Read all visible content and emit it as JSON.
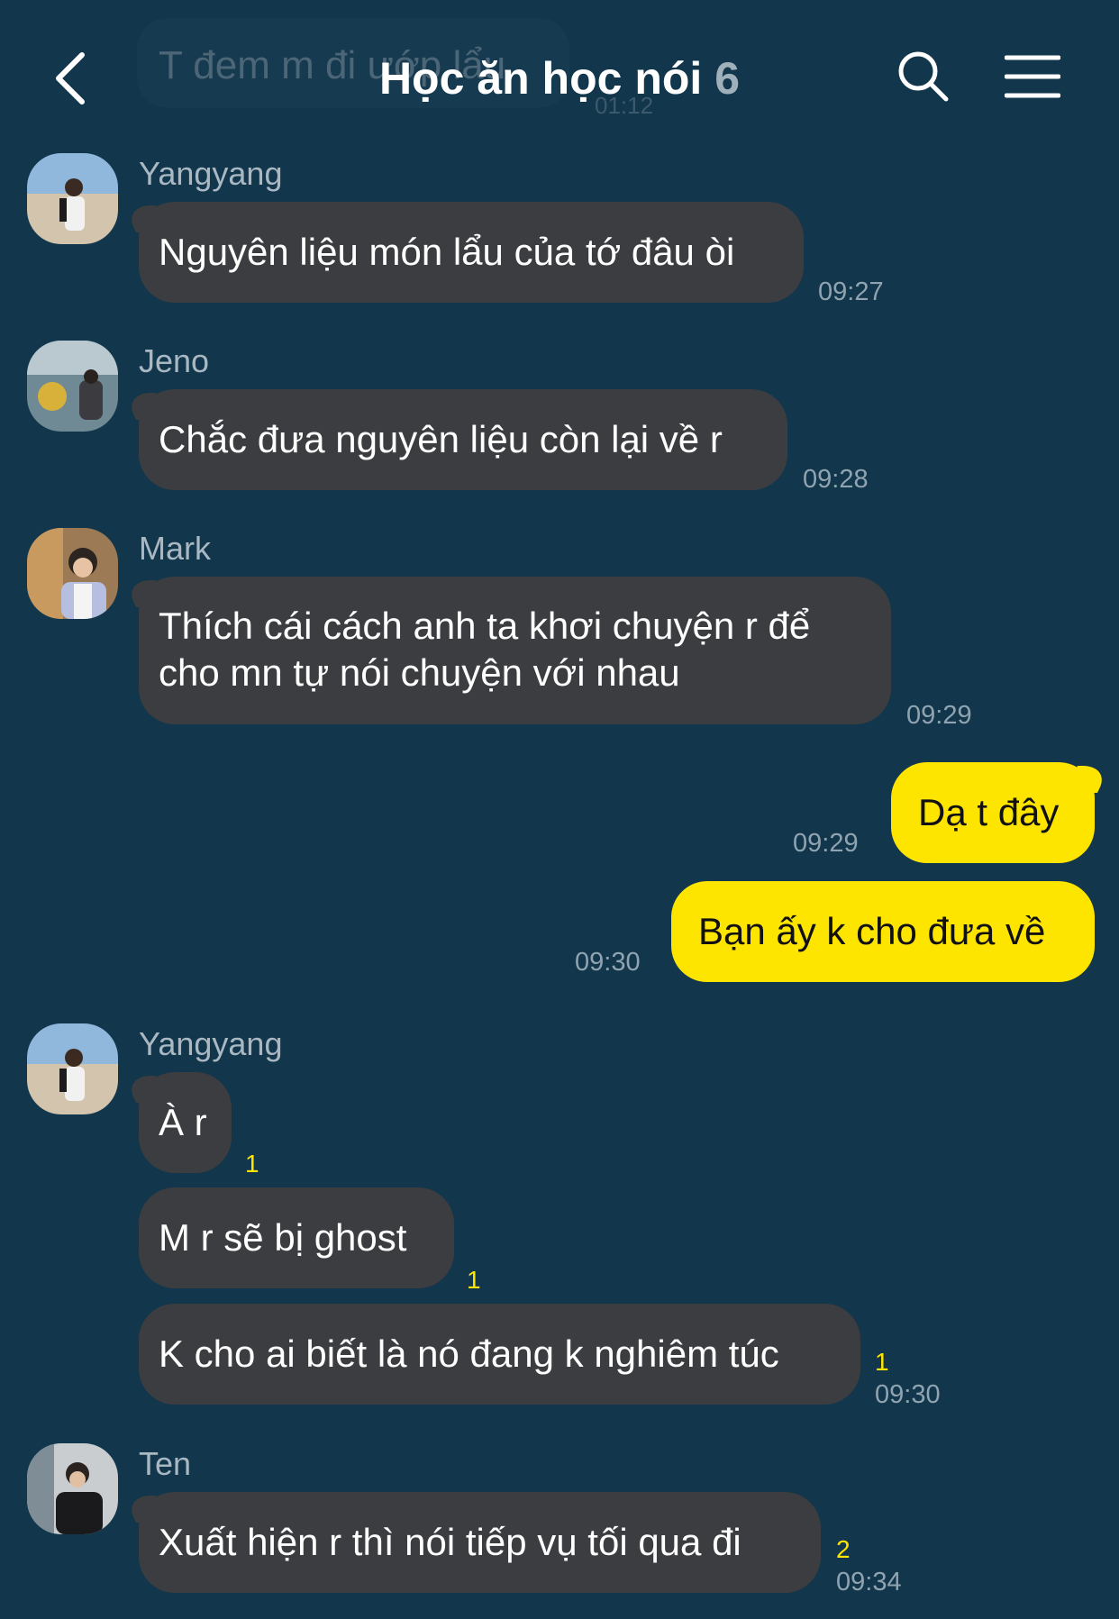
{
  "header": {
    "title": "Học ăn học nói",
    "member_count": "6",
    "background_preview_text": "T đem m đi ướp lẩu",
    "background_preview_time": "01:12"
  },
  "colors": {
    "background": "#12364b",
    "incoming_bubble": "#3c3d40",
    "outgoing_bubble": "#fee500",
    "unread_count": "#fee500",
    "timestamp": "#90a3b0"
  },
  "messages": [
    {
      "sender": "Yangyang",
      "text": "Nguyên liệu món lẩu của tớ đâu òi",
      "time": "09:27"
    },
    {
      "sender": "Jeno",
      "text": "Chắc đưa nguyên liệu còn lại về r",
      "time": "09:28"
    },
    {
      "sender": "Mark",
      "text_line1": "Thích cái cách anh ta khơi chuyện r để",
      "text_line2": "cho mn tự nói chuyện với nhau",
      "time": "09:29"
    },
    {
      "sender": "me",
      "text": "Dạ t đây",
      "time": "09:29"
    },
    {
      "sender": "me",
      "text": "Bạn ấy k cho đưa về",
      "time": "09:30"
    },
    {
      "sender": "Yangyang",
      "text": "À r",
      "unread": "1"
    },
    {
      "sender": "Yangyang",
      "text": "M r sẽ bị ghost",
      "unread": "1"
    },
    {
      "sender": "Yangyang",
      "text": "K cho ai biết là nó đang k nghiêm túc",
      "unread": "1",
      "time": "09:30"
    },
    {
      "sender": "Ten",
      "text": "Xuất hiện r thì nói tiếp vụ tối qua đi",
      "unread": "2",
      "time": "09:34"
    }
  ],
  "icons": {
    "back": "chevron-left-icon",
    "search": "search-icon",
    "menu": "hamburger-menu-icon"
  }
}
